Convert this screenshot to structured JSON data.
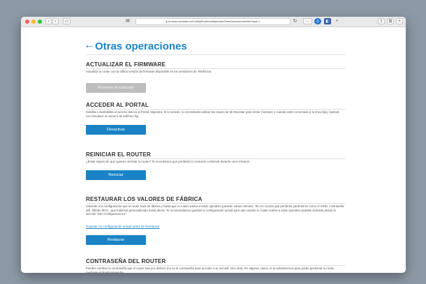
{
  "browser": {
    "url": "ai.www.movistar.es/ConfigRouters/Alejandra/OtrasOperaciones/list?app=1",
    "reload_icon": "reload-icon",
    "share_icon": "share-icon"
  },
  "page": {
    "title": "Otras operaciones"
  },
  "sections": [
    {
      "title": "ACTUALIZAR EL FIRMWARE",
      "description": "Actualiza tu router con la última versión de firmware disponible en los servidores de Telefónica.",
      "button": "Firmware Actualizado"
    },
    {
      "title": "ACCEDER AL PORTAL",
      "description": "Habilita o deshabilita el acceso directo al Portal Alejandra. Si lo activas, no necesitarás utilizar las claves de Mi Movistar para entrar (siempre y cuando estés conectado a tu línea fija), bastará con introducir el número de teléfono fijo.",
      "button": "Desactivar"
    },
    {
      "title": "REINICIAR EL ROUTER",
      "description": "¿Estás seguro de que quieres reiniciar tu router? Te recordamos que perderás la conexión a Internet durante unos minutos.",
      "button": "Reiniciar"
    },
    {
      "title": "RESTAURAR LOS VALORES DE FÁBRICA",
      "description": "Volverás a la configuración que el router traía de fábrica y hasta que tu router vuelva a estar operativo pasarán varios minutos. Ten en cuenta que perderás parámetros como el SSID, contraseña wifi, filtrado MAC...que hubieras personalizado hasta ahora. Te recomendamos guardar tu configuración actual para que cuando tu router vuelva a estar operativo puedas activarla desde la sección \"Mis Configuraciones\".",
      "link": "Guardar mi configuración actual antes de Restaurar",
      "button": "Restaurar"
    },
    {
      "title": "CONTRASEÑA DEL ROUTER",
      "description": "Puedes cambiar la contraseña que el router trae por defecto (no es la contraseña para acceder a tu red wifi, sino otra). En algunos casos, te la solicitaremos para poder gestionar tu router mediante el Portal Alejandra."
    }
  ]
}
